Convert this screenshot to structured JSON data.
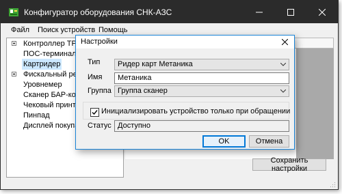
{
  "window": {
    "title": "Конфигуратор оборудования СНК-АЗС",
    "controls": {
      "minimize_icon": "minimize-icon",
      "maximize_icon": "maximize-icon",
      "close_icon": "close-icon"
    }
  },
  "menu": [
    {
      "label": "Файл"
    },
    {
      "label": "Поиск устройств"
    },
    {
      "label": "Помощь"
    }
  ],
  "tree": {
    "items": [
      {
        "label": "Контроллер ТРК",
        "expandable": true
      },
      {
        "label": "ПОС-терминал",
        "expandable": false
      },
      {
        "label": "Картридер",
        "expandable": false,
        "selected": true
      },
      {
        "label": "Фискальный регис",
        "expandable": true
      },
      {
        "label": "Уровнемер",
        "expandable": false
      },
      {
        "label": "Сканер БАР-кодов",
        "expandable": false
      },
      {
        "label": "Чековый принтер",
        "expandable": false
      },
      {
        "label": "Пинпад",
        "expandable": false
      },
      {
        "label": "Дисплей покупател",
        "expandable": false
      }
    ]
  },
  "main": {
    "save_label": "Сохранить настройки"
  },
  "dialog": {
    "title": "Настройки",
    "type_label": "Тип",
    "type_value": "Ридер карт Метаника",
    "name_label": "Имя",
    "name_value": "Метаника",
    "group_label": "Группа",
    "group_value": "Группа сканер",
    "init_checkbox_label": "Инициализировать устройство только при обращении",
    "init_checked": true,
    "status_label": "Статус",
    "status_value": "Доступно",
    "ok_label": "OK",
    "cancel_label": "Отмена"
  },
  "colors": {
    "titlebar": "#2b2b2b",
    "dialog_border": "#1883d7",
    "selection": "#cce8ff",
    "app_icon_green": "#3fa535"
  }
}
